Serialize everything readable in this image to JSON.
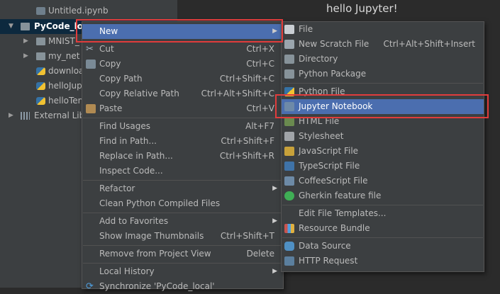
{
  "editor": {
    "title": "hello Jupyter!"
  },
  "project_tree": {
    "items": [
      {
        "label": "Untitled.ipynb"
      },
      {
        "label": "PyCode_loc"
      },
      {
        "label": "MNIST_"
      },
      {
        "label": "my_net"
      },
      {
        "label": "downloa"
      },
      {
        "label": "helloJup"
      },
      {
        "label": "helloTen"
      },
      {
        "label": "External Lib"
      }
    ]
  },
  "context_menu": {
    "items": [
      {
        "label": "New"
      },
      {
        "label": "Cut",
        "shortcut": "Ctrl+X"
      },
      {
        "label": "Copy",
        "shortcut": "Ctrl+C"
      },
      {
        "label": "Copy Path",
        "shortcut": "Ctrl+Shift+C"
      },
      {
        "label": "Copy Relative Path",
        "shortcut": "Ctrl+Alt+Shift+C"
      },
      {
        "label": "Paste",
        "shortcut": "Ctrl+V"
      },
      {
        "label": "Find Usages",
        "shortcut": "Alt+F7"
      },
      {
        "label": "Find in Path...",
        "shortcut": "Ctrl+Shift+F"
      },
      {
        "label": "Replace in Path...",
        "shortcut": "Ctrl+Shift+R"
      },
      {
        "label": "Inspect Code..."
      },
      {
        "label": "Refactor"
      },
      {
        "label": "Clean Python Compiled Files"
      },
      {
        "label": "Add to Favorites"
      },
      {
        "label": "Show Image Thumbnails",
        "shortcut": "Ctrl+Shift+T"
      },
      {
        "label": "Remove from Project View",
        "shortcut": "Delete"
      },
      {
        "label": "Local History"
      },
      {
        "label": "Synchronize 'PyCode_local'"
      }
    ]
  },
  "new_submenu": {
    "items": [
      {
        "label": "File"
      },
      {
        "label": "New Scratch File",
        "shortcut": "Ctrl+Alt+Shift+Insert"
      },
      {
        "label": "Directory"
      },
      {
        "label": "Python Package"
      },
      {
        "label": "Python File"
      },
      {
        "label": "Jupyter Notebook"
      },
      {
        "label": "HTML File"
      },
      {
        "label": "Stylesheet"
      },
      {
        "label": "JavaScript File"
      },
      {
        "label": "TypeScript File"
      },
      {
        "label": "CoffeeScript File"
      },
      {
        "label": "Gherkin feature file"
      },
      {
        "label": "Edit File Templates..."
      },
      {
        "label": "Resource Bundle"
      },
      {
        "label": "Data Source"
      },
      {
        "label": "HTTP Request"
      }
    ]
  },
  "colors": {
    "highlight": "#4b6eaf",
    "annotation_box": "#e03c3c"
  }
}
